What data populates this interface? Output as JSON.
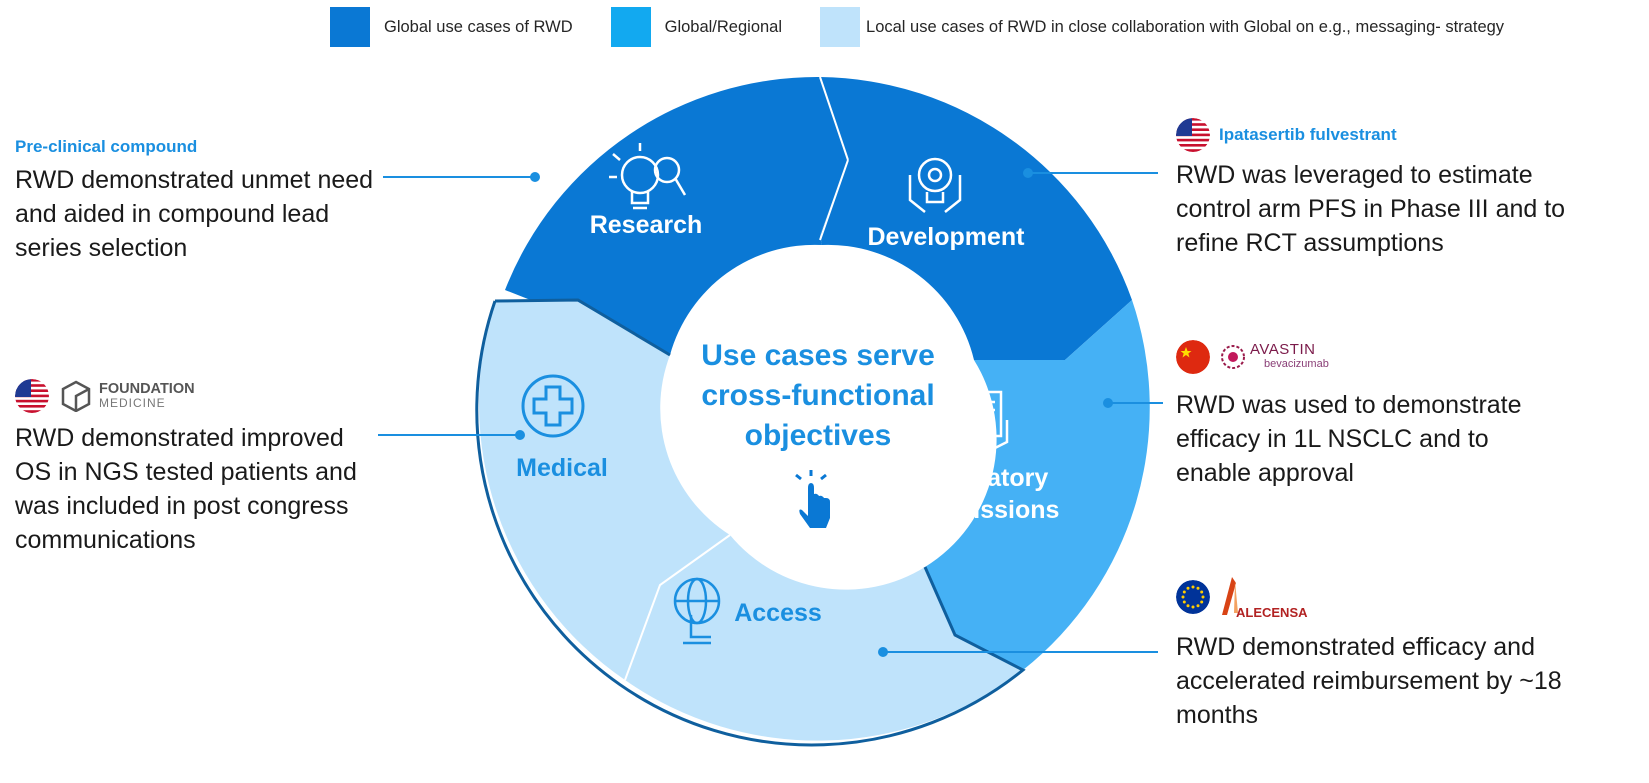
{
  "legend": [
    {
      "label": "Global use cases of RWD",
      "color": "#0a78d4"
    },
    {
      "label": "Global/Regional",
      "color": "#12a9f0"
    },
    {
      "label": "Local use cases of RWD in close collaboration with Global on e.g., messaging- strategy",
      "color": "#bfe3fb"
    }
  ],
  "center": {
    "line1": "Use cases serve",
    "line2": "cross-functional",
    "line3": "objectives"
  },
  "segments": {
    "research": {
      "label": "Research",
      "color": "#0a78d4"
    },
    "development": {
      "label": "Development",
      "color": "#0a78d4"
    },
    "regulatory": {
      "line1": "Regulatory",
      "line2": "submissions",
      "color": "#45b1f5"
    },
    "access": {
      "label": "Access",
      "color": "#bfe3fb"
    },
    "medical": {
      "label": "Medical",
      "color": "#bfe3fb"
    }
  },
  "callouts": {
    "preclinical": {
      "title": "Pre-clinical compound",
      "text": "RWD demonstrated unmet need and aided in compound lead series selection"
    },
    "ipatasertib": {
      "title": "Ipatasertib fulvestrant",
      "text": "RWD was leveraged to estimate control arm PFS in Phase III and to refine RCT assumptions"
    },
    "foundation": {
      "logo_line1": "FOUNDATION",
      "logo_line2": "MEDICINE",
      "text": "RWD demonstrated improved OS in NGS tested patients and was included in post congress communications"
    },
    "avastin": {
      "logo_line1": "AVASTIN",
      "logo_line2": "bevacizumab",
      "text": "RWD was used to demonstrate efficacy in 1L NSCLC and to enable approval"
    },
    "alecensa": {
      "logo": "ALECENSA",
      "text": "RWD demonstrated efficacy and accelerated reimbursement by ~18 months"
    }
  },
  "icons": {
    "research": "lightbulb-magnifier-icon",
    "development": "gear-lightbulb-hands-icon",
    "regulatory": "document-hands-icon",
    "access": "globe-hand-icon",
    "medical": "medical-cross-icon",
    "center": "pointer-hand-click-icon"
  }
}
